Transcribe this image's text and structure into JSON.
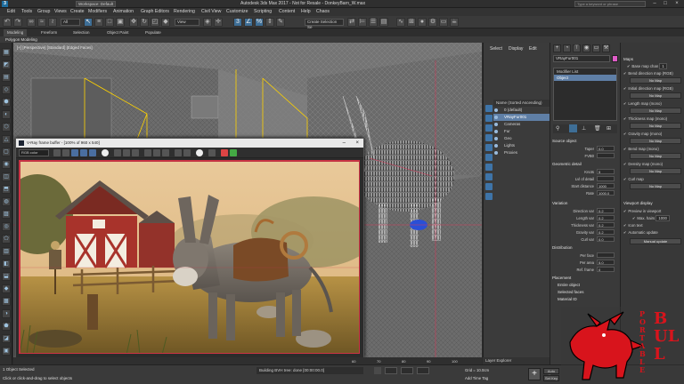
{
  "window": {
    "title": "Autodesk 3ds Max 2017 - Not for Resale - DonkeyBarn_W.max",
    "workspace": "Workspace: Default",
    "search_placeholder": "Type a keyword or phrase"
  },
  "menu": [
    "Edit",
    "Tools",
    "Group",
    "Views",
    "Create",
    "Modifiers",
    "Animation",
    "Graph Editors",
    "Rendering",
    "Civil View",
    "Customize",
    "Scripting",
    "Content",
    "Help",
    "Chaos"
  ],
  "toolbar": {
    "selection_filter": "All",
    "view_dropdown": "View",
    "selection_set": "Create Selection Se"
  },
  "ribbon": {
    "tabs": [
      "Modeling",
      "Freeform",
      "Selection",
      "Object Paint",
      "Populate"
    ],
    "active_tab": "Modeling",
    "subpanel": "Polygon Modeling"
  },
  "viewport": {
    "label": "[+] [Perspective] [Standard] [Edged Faces]"
  },
  "frame_buffer": {
    "title": "V-Ray frame buffer - [100% of 960 x 540]",
    "channel": "RGB color"
  },
  "scene_explorer": {
    "tabs": [
      "Select",
      "Display",
      "Edit"
    ],
    "sort_header": "Name (Sorted Ascending)",
    "items": [
      {
        "label": "0 (default)",
        "selected": false
      },
      {
        "label": "VRayFur001",
        "selected": true
      },
      {
        "label": "Cameras",
        "selected": false
      },
      {
        "label": "Fur",
        "selected": false
      },
      {
        "label": "Geo",
        "selected": false
      },
      {
        "label": "Lights",
        "selected": false
      },
      {
        "label": "Proxies",
        "selected": false
      }
    ],
    "layer_explorer": "Layer Explorer"
  },
  "modify_panel": {
    "object_name": "VRayFur001",
    "modifier_list": "Modifier List",
    "stack_item": "Object",
    "source_object": "Source object",
    "params": [
      {
        "label": "Taper",
        "value": "0.0"
      },
      {
        "label": "FVB0",
        "value": ""
      }
    ],
    "geometric_detail_title": "Geometric detail",
    "geometric_detail": [
      {
        "label": "Knots",
        "value": "5"
      },
      {
        "label": "Lvl of detail",
        "value": ""
      },
      {
        "label": "Start distance",
        "value": "1000"
      },
      {
        "label": "Rate",
        "value": "1000.0"
      }
    ],
    "variation_title": "Variation",
    "variation": [
      {
        "label": "Direction var",
        "value": "0.2"
      },
      {
        "label": "Length var",
        "value": "0.2"
      },
      {
        "label": "Thickness var",
        "value": "0.2"
      },
      {
        "label": "Gravity var",
        "value": "0.2"
      },
      {
        "label": "Curl var",
        "value": "0.0"
      }
    ],
    "distribution_title": "Distribution",
    "distribution": [
      {
        "label": "Per face",
        "value": ""
      },
      {
        "label": "Per area",
        "value": "5.0"
      },
      {
        "label": "Ref. frame",
        "value": "0"
      }
    ],
    "placement_title": "Placement",
    "placement": [
      "Entire object",
      "Selected faces",
      "Material ID"
    ]
  },
  "maps_panel": {
    "maps_title": "Maps",
    "base_map_channel_label": "Base map chan",
    "base_map_channel_value": "1",
    "maps": [
      "Bend direction map (RGB)",
      "Initial direction map (RGB)",
      "Length map (mono)",
      "Thickness map (mono)",
      "Gravity map (mono)",
      "Bend map (mono)",
      "Density map (mono)",
      "Curl map"
    ],
    "no_map_label": "No Map",
    "viewport_display_title": "Viewport display",
    "preview_label": "Preview in viewport",
    "max_hairs_label": "Max. hairs",
    "max_hairs_value": "1000",
    "icon_text_label": "Icon text",
    "auto_update_label": "Automatic update",
    "manual_update_label": "Manual update"
  },
  "status": {
    "selection": "1 Object Selected",
    "hint": "Click or click-and-drag to select objects",
    "bvh": "Building BVH tree: done [00:00:00.0]",
    "grid": "Grid = 10.0cm",
    "add_time_tag": "Add Time Tag",
    "auto_key": "Auto Key",
    "set_key": "Set Key",
    "time_ticks": [
      "60",
      "70",
      "80",
      "90",
      "100"
    ]
  },
  "watermark": {
    "left_text": "PORTABLE",
    "right_text": "BULL"
  },
  "colors": {
    "selection_blue": "#5f7fa6",
    "accent_blue": "#3e6e96",
    "render_border": "#c33344",
    "bull_red": "#d8141c"
  },
  "icons": [
    "undo-icon",
    "redo-icon",
    "link-icon",
    "unlink-icon",
    "select-icon",
    "move-icon",
    "rotate-icon",
    "scale-icon",
    "snap-icon",
    "render-icon",
    "teapot-icon"
  ]
}
